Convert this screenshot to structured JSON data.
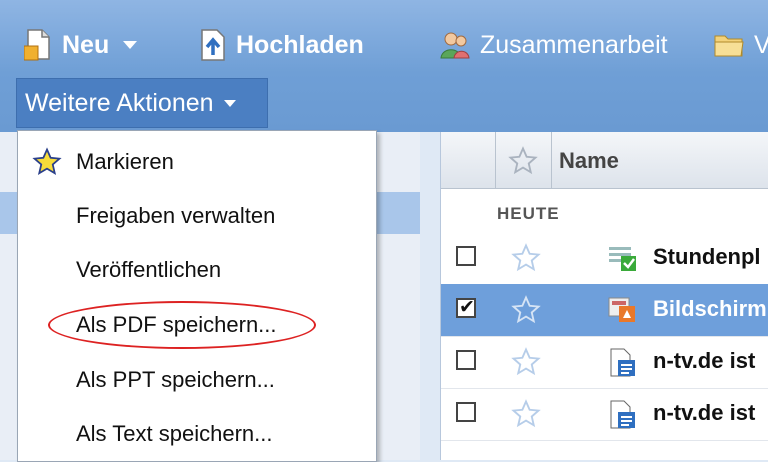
{
  "toolbar": {
    "new_label": "Neu",
    "upload_label": "Hochladen",
    "collab_label": "Zusammenarbeit",
    "folder_label": "V"
  },
  "more_actions": {
    "label": "Weitere Aktionen"
  },
  "menu": {
    "items": [
      {
        "label": "Markieren",
        "icon": "star-icon"
      },
      {
        "label": "Freigaben verwalten"
      },
      {
        "label": "Veröffentlichen"
      },
      {
        "label": "Als PDF speichern..."
      },
      {
        "label": "Als PPT speichern..."
      },
      {
        "label": "Als Text speichern..."
      }
    ],
    "highlight_color": "#dd2222"
  },
  "file_list": {
    "column_name": "Name",
    "group_today": "HEUTE",
    "rows": [
      {
        "title": "Stundenpl",
        "checked": false,
        "icon": "spreadsheet-icon"
      },
      {
        "title": "Bildschirm",
        "checked": true,
        "icon": "presentation-icon"
      },
      {
        "title": "n-tv.de ist",
        "checked": false,
        "icon": "document-icon"
      },
      {
        "title": "n-tv.de ist",
        "checked": false,
        "icon": "document-icon"
      }
    ]
  },
  "colors": {
    "toolbar": "#6f9fd6",
    "selected_row": "#6e9fdb",
    "menu_border": "#9aa6b5"
  }
}
